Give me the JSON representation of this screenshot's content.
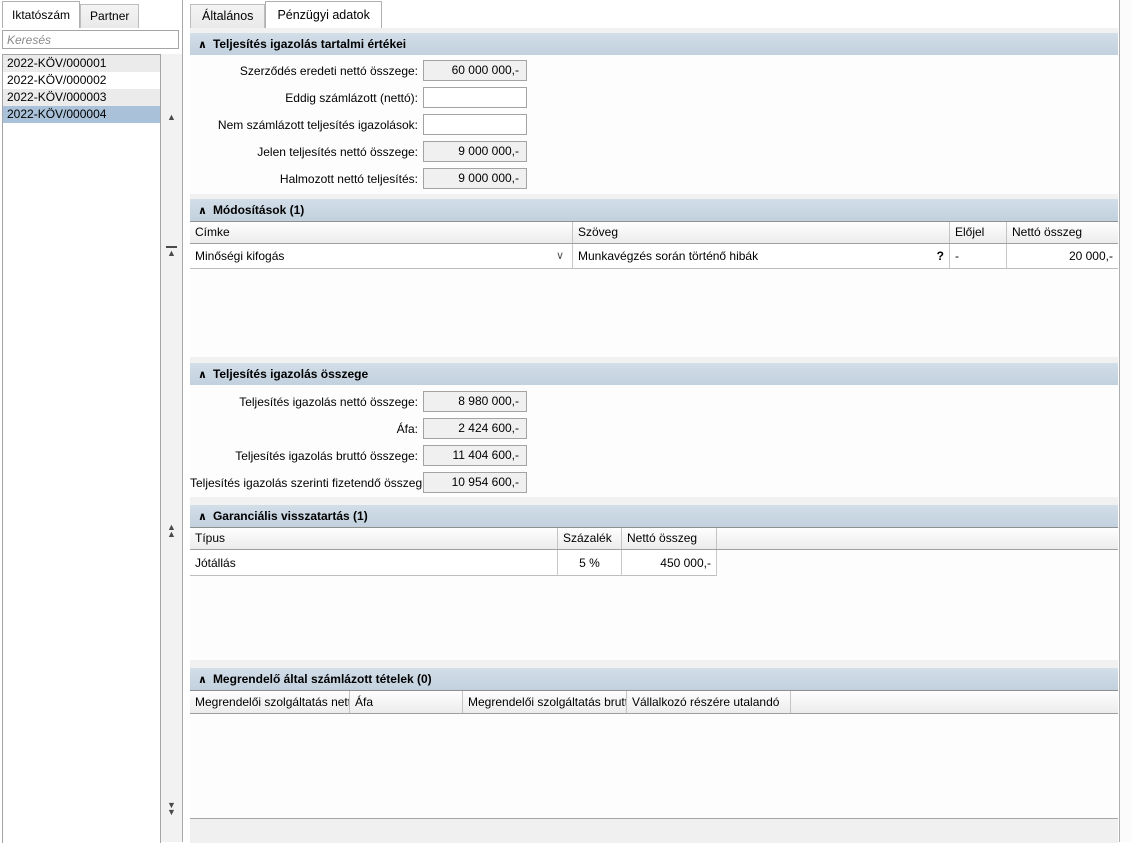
{
  "icons": {
    "collapse": "∧",
    "dropdown": "∨",
    "help": "?",
    "arrow_up": "▲",
    "arrow_down": "▼"
  },
  "sidebar": {
    "tabs": [
      {
        "label": "Iktatószám"
      },
      {
        "label": "Partner"
      }
    ],
    "search_placeholder": "Keresés",
    "list": [
      "2022-KÖV/000001",
      "2022-KÖV/000002",
      "2022-KÖV/000003",
      "2022-KÖV/000004"
    ],
    "selected_item": "2022-KÖV/000004"
  },
  "main": {
    "tabs": [
      {
        "label": "Általános"
      },
      {
        "label": "Pénzügyi adatok"
      }
    ],
    "sections": {
      "tartalmi": {
        "title": "Teljesítés igazolás tartalmi értékei",
        "fields": [
          {
            "label": "Szerződés eredeti nettó összege:",
            "value": "60 000 000,-"
          },
          {
            "label": "Eddig számlázott (nettó):",
            "value": ""
          },
          {
            "label": "Nem számlázott teljesítés igazolások:",
            "value": ""
          },
          {
            "label": "Jelen teljesítés nettó összege:",
            "value": "9 000 000,-"
          },
          {
            "label": "Halmozott nettó teljesítés:",
            "value": "9 000 000,-"
          }
        ]
      },
      "modositasok": {
        "title": "Módosítások (1)",
        "columns": [
          "Címke",
          "Szöveg",
          "Előjel",
          "Nettó összeg"
        ],
        "rows": [
          {
            "cimke": "Minőségi kifogás",
            "szoveg": "Munkavégzés során történő hibák",
            "elojel": "-",
            "netto": "20 000,-"
          }
        ]
      },
      "osszege": {
        "title": "Teljesítés igazolás összege",
        "fields": [
          {
            "label": "Teljesítés igazolás nettó összege:",
            "value": "8 980 000,-"
          },
          {
            "label": "Áfa:",
            "value": "2 424 600,-"
          },
          {
            "label": "Teljesítés igazolás bruttó összege:",
            "value": "11 404 600,-"
          },
          {
            "label": "Teljesítés igazolás szerinti fizetendő összeg:",
            "value": "10 954 600,-"
          }
        ]
      },
      "garancialis": {
        "title": "Garanciális visszatartás (1)",
        "columns": [
          "Típus",
          "Százalék",
          "Nettó összeg"
        ],
        "rows": [
          {
            "tipus": "Jótállás",
            "szazalek": "5 %",
            "netto": "450 000,-"
          }
        ]
      },
      "megrendelo": {
        "title": "Megrendelő által számlázott tételek (0)",
        "columns": [
          "Megrendelői szolgáltatás nettó",
          "Áfa",
          "Megrendelői szolgáltatás bruttó",
          "Vállalkozó részére utalandó"
        ]
      }
    }
  }
}
